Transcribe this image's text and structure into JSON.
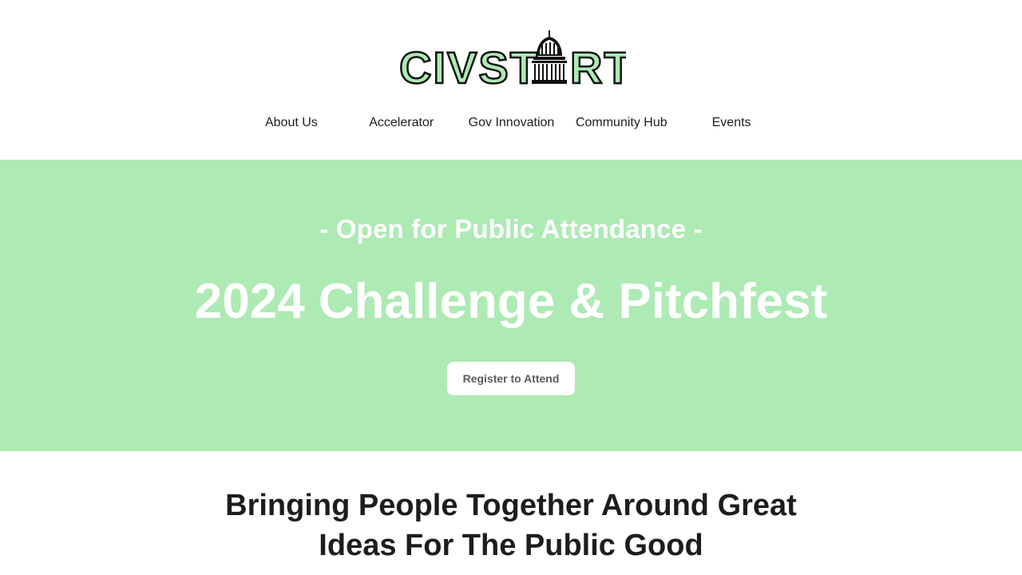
{
  "logo": {
    "text_left": "CIVST",
    "text_right": "RT",
    "accent_color": "#adeab4",
    "icon": "capitol-dome-icon"
  },
  "nav": {
    "items": [
      {
        "label": "About Us"
      },
      {
        "label": "Accelerator"
      },
      {
        "label": "Gov Innovation"
      },
      {
        "label": "Community Hub"
      },
      {
        "label": "Events"
      }
    ]
  },
  "hero": {
    "subtitle": "- Open for Public Attendance -",
    "title": "2024 Challenge & Pitchfest",
    "button_label": "Register to Attend",
    "background_color": "#adeab4"
  },
  "section": {
    "heading_line1": "Bringing People Together Around Great",
    "heading_line2": "Ideas For The Public Good"
  }
}
